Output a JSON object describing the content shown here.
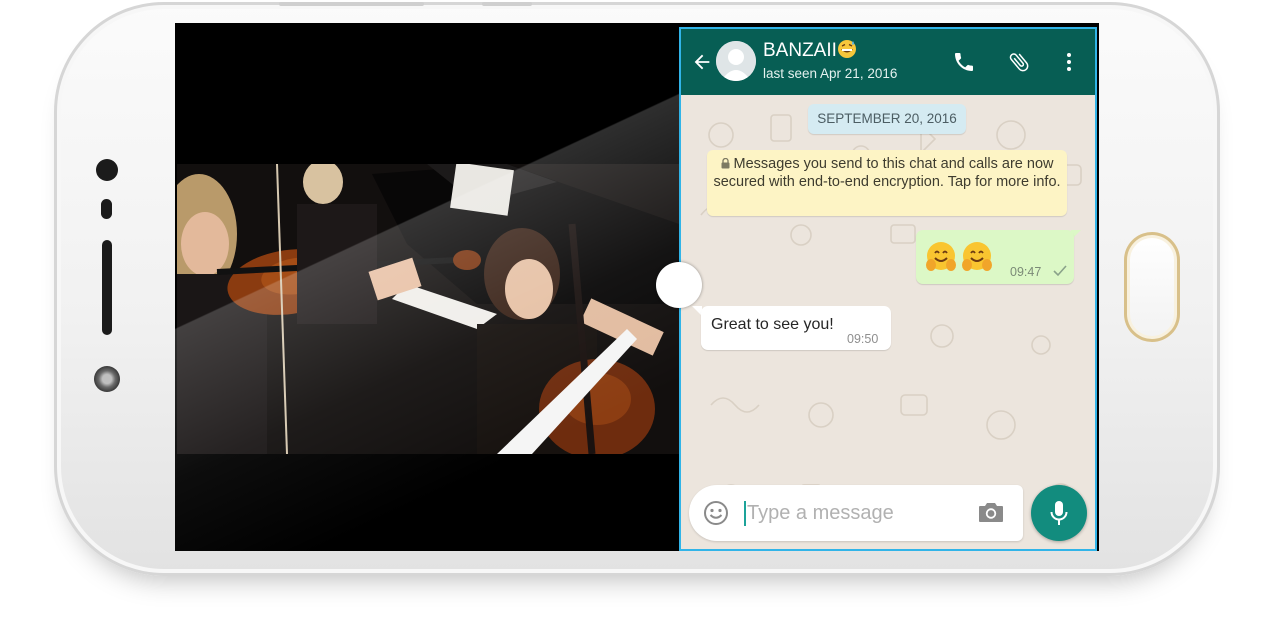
{
  "chat": {
    "contact_name": "BANZAII",
    "contact_status": "last seen Apr 21, 2016",
    "date_divider": "SEPTEMBER 20, 2016",
    "encryption_notice": "Messages you send to this chat and calls are now secured with end-to-end encryption. Tap for more info.",
    "messages": [
      {
        "direction": "outgoing",
        "content": "🤗🤗",
        "time": "09:47",
        "status": "sent-check"
      },
      {
        "direction": "incoming",
        "content": "Great to see you!",
        "time": "09:50"
      }
    ],
    "input_placeholder": "Type a message"
  },
  "icons": {
    "header": [
      "back-arrow",
      "avatar",
      "grinning-sweat-emoji",
      "phone",
      "paperclip",
      "more-vertical"
    ],
    "input": [
      "smiley",
      "camera",
      "microphone"
    ]
  },
  "colors": {
    "header_green": "#075e54",
    "mic_button": "#128c7e",
    "outgoing_bubble": "#dcf8c6",
    "chat_background": "#ece5dd",
    "date_pill": "#d5ebf2",
    "encryption_note": "#fdf4c5",
    "split_border": "#31b4e8"
  }
}
